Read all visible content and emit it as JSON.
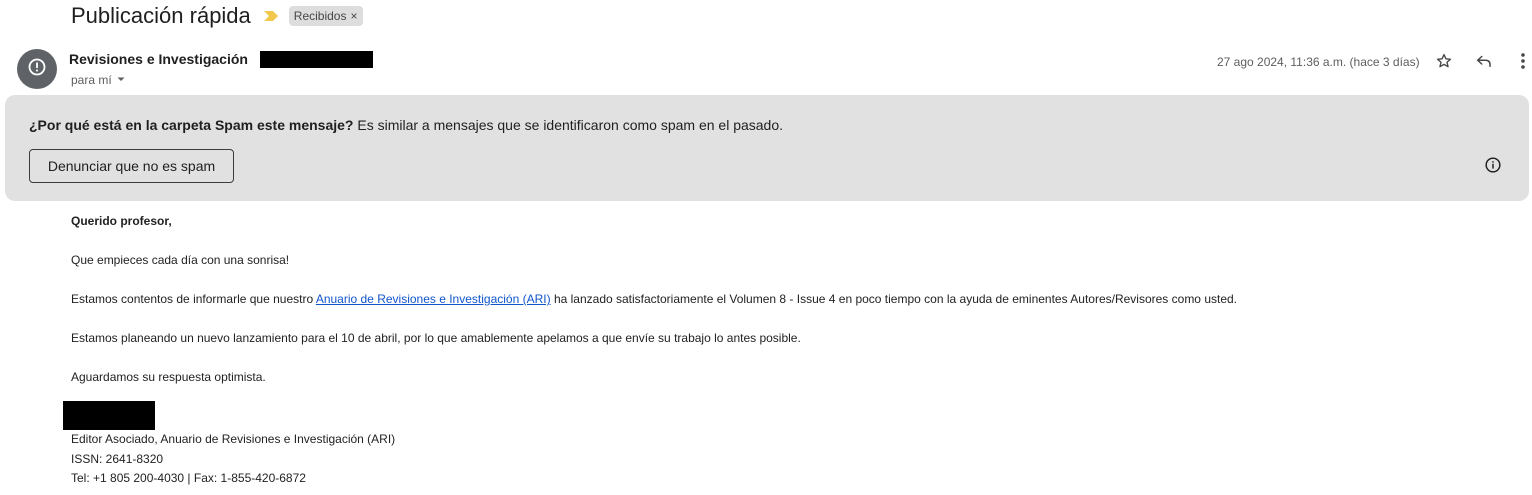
{
  "subject": {
    "title": "Publicación rápida",
    "label": "Recibidos",
    "label_remove": "×"
  },
  "sender": {
    "name": "Revisiones e Investigación",
    "recipient": "para mí",
    "date": "27 ago 2024, 11:36 a.m. (hace 3 días)"
  },
  "icons": {
    "avatar": "alert-circle-icon",
    "star": "star-icon",
    "reply": "reply-icon",
    "more": "more-vert-icon",
    "info": "info-icon",
    "recipient_dropdown": "chevron-down-icon",
    "importance": "importance-marker-icon"
  },
  "colors": {
    "importance_marker": "#f2c94c",
    "link": "#1155cc",
    "banner_bg": "#e1e1e1",
    "avatar_bg": "#5f6368"
  },
  "spam_banner": {
    "question": "¿Por qué está en la carpeta Spam este mensaje?",
    "explanation": " Es similar a mensajes que se identificaron como spam en el pasado.",
    "button": "Denunciar que no es spam"
  },
  "body": {
    "greeting": "Querido profesor,",
    "line1": "Que empieces cada día con una sonrisa!",
    "line2_pre": "Estamos contentos de informarle que nuestro ",
    "line2_link": "Anuario de Revisiones e Investigación (ARI)",
    "line2_post": " ha lanzado satisfactoriamente el Volumen 8 - Issue 4 en poco tiempo con la ayuda de eminentes Autores/Revisores como usted.",
    "line3": "Estamos planeando un nuevo lanzamiento para el 10 de abril, por lo que amablemente apelamos a que envíe su trabajo lo antes posible.",
    "line4": "Aguardamos su respuesta optimista."
  },
  "signature": {
    "role": "Editor Asociado,  Anuario de Revisiones e Investigación (ARI)",
    "issn": "ISSN: 2641-8320",
    "contact": "Tel: +1 805 200-4030 | Fax: 1-855-420-6872"
  }
}
